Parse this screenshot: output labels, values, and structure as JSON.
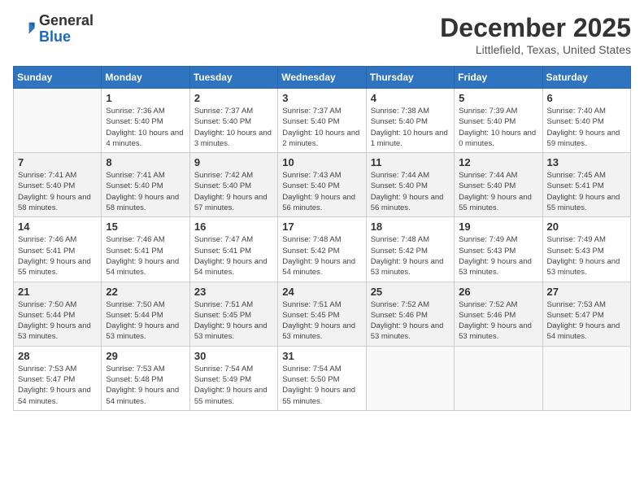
{
  "header": {
    "logo_general": "General",
    "logo_blue": "Blue",
    "month_title": "December 2025",
    "location": "Littlefield, Texas, United States"
  },
  "days_of_week": [
    "Sunday",
    "Monday",
    "Tuesday",
    "Wednesday",
    "Thursday",
    "Friday",
    "Saturday"
  ],
  "weeks": [
    [
      {
        "day": "",
        "sunrise": "",
        "sunset": "",
        "daylight": ""
      },
      {
        "day": "1",
        "sunrise": "Sunrise: 7:36 AM",
        "sunset": "Sunset: 5:40 PM",
        "daylight": "Daylight: 10 hours and 4 minutes."
      },
      {
        "day": "2",
        "sunrise": "Sunrise: 7:37 AM",
        "sunset": "Sunset: 5:40 PM",
        "daylight": "Daylight: 10 hours and 3 minutes."
      },
      {
        "day": "3",
        "sunrise": "Sunrise: 7:37 AM",
        "sunset": "Sunset: 5:40 PM",
        "daylight": "Daylight: 10 hours and 2 minutes."
      },
      {
        "day": "4",
        "sunrise": "Sunrise: 7:38 AM",
        "sunset": "Sunset: 5:40 PM",
        "daylight": "Daylight: 10 hours and 1 minute."
      },
      {
        "day": "5",
        "sunrise": "Sunrise: 7:39 AM",
        "sunset": "Sunset: 5:40 PM",
        "daylight": "Daylight: 10 hours and 0 minutes."
      },
      {
        "day": "6",
        "sunrise": "Sunrise: 7:40 AM",
        "sunset": "Sunset: 5:40 PM",
        "daylight": "Daylight: 9 hours and 59 minutes."
      }
    ],
    [
      {
        "day": "7",
        "sunrise": "Sunrise: 7:41 AM",
        "sunset": "Sunset: 5:40 PM",
        "daylight": "Daylight: 9 hours and 58 minutes."
      },
      {
        "day": "8",
        "sunrise": "Sunrise: 7:41 AM",
        "sunset": "Sunset: 5:40 PM",
        "daylight": "Daylight: 9 hours and 58 minutes."
      },
      {
        "day": "9",
        "sunrise": "Sunrise: 7:42 AM",
        "sunset": "Sunset: 5:40 PM",
        "daylight": "Daylight: 9 hours and 57 minutes."
      },
      {
        "day": "10",
        "sunrise": "Sunrise: 7:43 AM",
        "sunset": "Sunset: 5:40 PM",
        "daylight": "Daylight: 9 hours and 56 minutes."
      },
      {
        "day": "11",
        "sunrise": "Sunrise: 7:44 AM",
        "sunset": "Sunset: 5:40 PM",
        "daylight": "Daylight: 9 hours and 56 minutes."
      },
      {
        "day": "12",
        "sunrise": "Sunrise: 7:44 AM",
        "sunset": "Sunset: 5:40 PM",
        "daylight": "Daylight: 9 hours and 55 minutes."
      },
      {
        "day": "13",
        "sunrise": "Sunrise: 7:45 AM",
        "sunset": "Sunset: 5:41 PM",
        "daylight": "Daylight: 9 hours and 55 minutes."
      }
    ],
    [
      {
        "day": "14",
        "sunrise": "Sunrise: 7:46 AM",
        "sunset": "Sunset: 5:41 PM",
        "daylight": "Daylight: 9 hours and 55 minutes."
      },
      {
        "day": "15",
        "sunrise": "Sunrise: 7:46 AM",
        "sunset": "Sunset: 5:41 PM",
        "daylight": "Daylight: 9 hours and 54 minutes."
      },
      {
        "day": "16",
        "sunrise": "Sunrise: 7:47 AM",
        "sunset": "Sunset: 5:41 PM",
        "daylight": "Daylight: 9 hours and 54 minutes."
      },
      {
        "day": "17",
        "sunrise": "Sunrise: 7:48 AM",
        "sunset": "Sunset: 5:42 PM",
        "daylight": "Daylight: 9 hours and 54 minutes."
      },
      {
        "day": "18",
        "sunrise": "Sunrise: 7:48 AM",
        "sunset": "Sunset: 5:42 PM",
        "daylight": "Daylight: 9 hours and 53 minutes."
      },
      {
        "day": "19",
        "sunrise": "Sunrise: 7:49 AM",
        "sunset": "Sunset: 5:43 PM",
        "daylight": "Daylight: 9 hours and 53 minutes."
      },
      {
        "day": "20",
        "sunrise": "Sunrise: 7:49 AM",
        "sunset": "Sunset: 5:43 PM",
        "daylight": "Daylight: 9 hours and 53 minutes."
      }
    ],
    [
      {
        "day": "21",
        "sunrise": "Sunrise: 7:50 AM",
        "sunset": "Sunset: 5:44 PM",
        "daylight": "Daylight: 9 hours and 53 minutes."
      },
      {
        "day": "22",
        "sunrise": "Sunrise: 7:50 AM",
        "sunset": "Sunset: 5:44 PM",
        "daylight": "Daylight: 9 hours and 53 minutes."
      },
      {
        "day": "23",
        "sunrise": "Sunrise: 7:51 AM",
        "sunset": "Sunset: 5:45 PM",
        "daylight": "Daylight: 9 hours and 53 minutes."
      },
      {
        "day": "24",
        "sunrise": "Sunrise: 7:51 AM",
        "sunset": "Sunset: 5:45 PM",
        "daylight": "Daylight: 9 hours and 53 minutes."
      },
      {
        "day": "25",
        "sunrise": "Sunrise: 7:52 AM",
        "sunset": "Sunset: 5:46 PM",
        "daylight": "Daylight: 9 hours and 53 minutes."
      },
      {
        "day": "26",
        "sunrise": "Sunrise: 7:52 AM",
        "sunset": "Sunset: 5:46 PM",
        "daylight": "Daylight: 9 hours and 53 minutes."
      },
      {
        "day": "27",
        "sunrise": "Sunrise: 7:53 AM",
        "sunset": "Sunset: 5:47 PM",
        "daylight": "Daylight: 9 hours and 54 minutes."
      }
    ],
    [
      {
        "day": "28",
        "sunrise": "Sunrise: 7:53 AM",
        "sunset": "Sunset: 5:47 PM",
        "daylight": "Daylight: 9 hours and 54 minutes."
      },
      {
        "day": "29",
        "sunrise": "Sunrise: 7:53 AM",
        "sunset": "Sunset: 5:48 PM",
        "daylight": "Daylight: 9 hours and 54 minutes."
      },
      {
        "day": "30",
        "sunrise": "Sunrise: 7:54 AM",
        "sunset": "Sunset: 5:49 PM",
        "daylight": "Daylight: 9 hours and 55 minutes."
      },
      {
        "day": "31",
        "sunrise": "Sunrise: 7:54 AM",
        "sunset": "Sunset: 5:50 PM",
        "daylight": "Daylight: 9 hours and 55 minutes."
      },
      {
        "day": "",
        "sunrise": "",
        "sunset": "",
        "daylight": ""
      },
      {
        "day": "",
        "sunrise": "",
        "sunset": "",
        "daylight": ""
      },
      {
        "day": "",
        "sunrise": "",
        "sunset": "",
        "daylight": ""
      }
    ]
  ]
}
